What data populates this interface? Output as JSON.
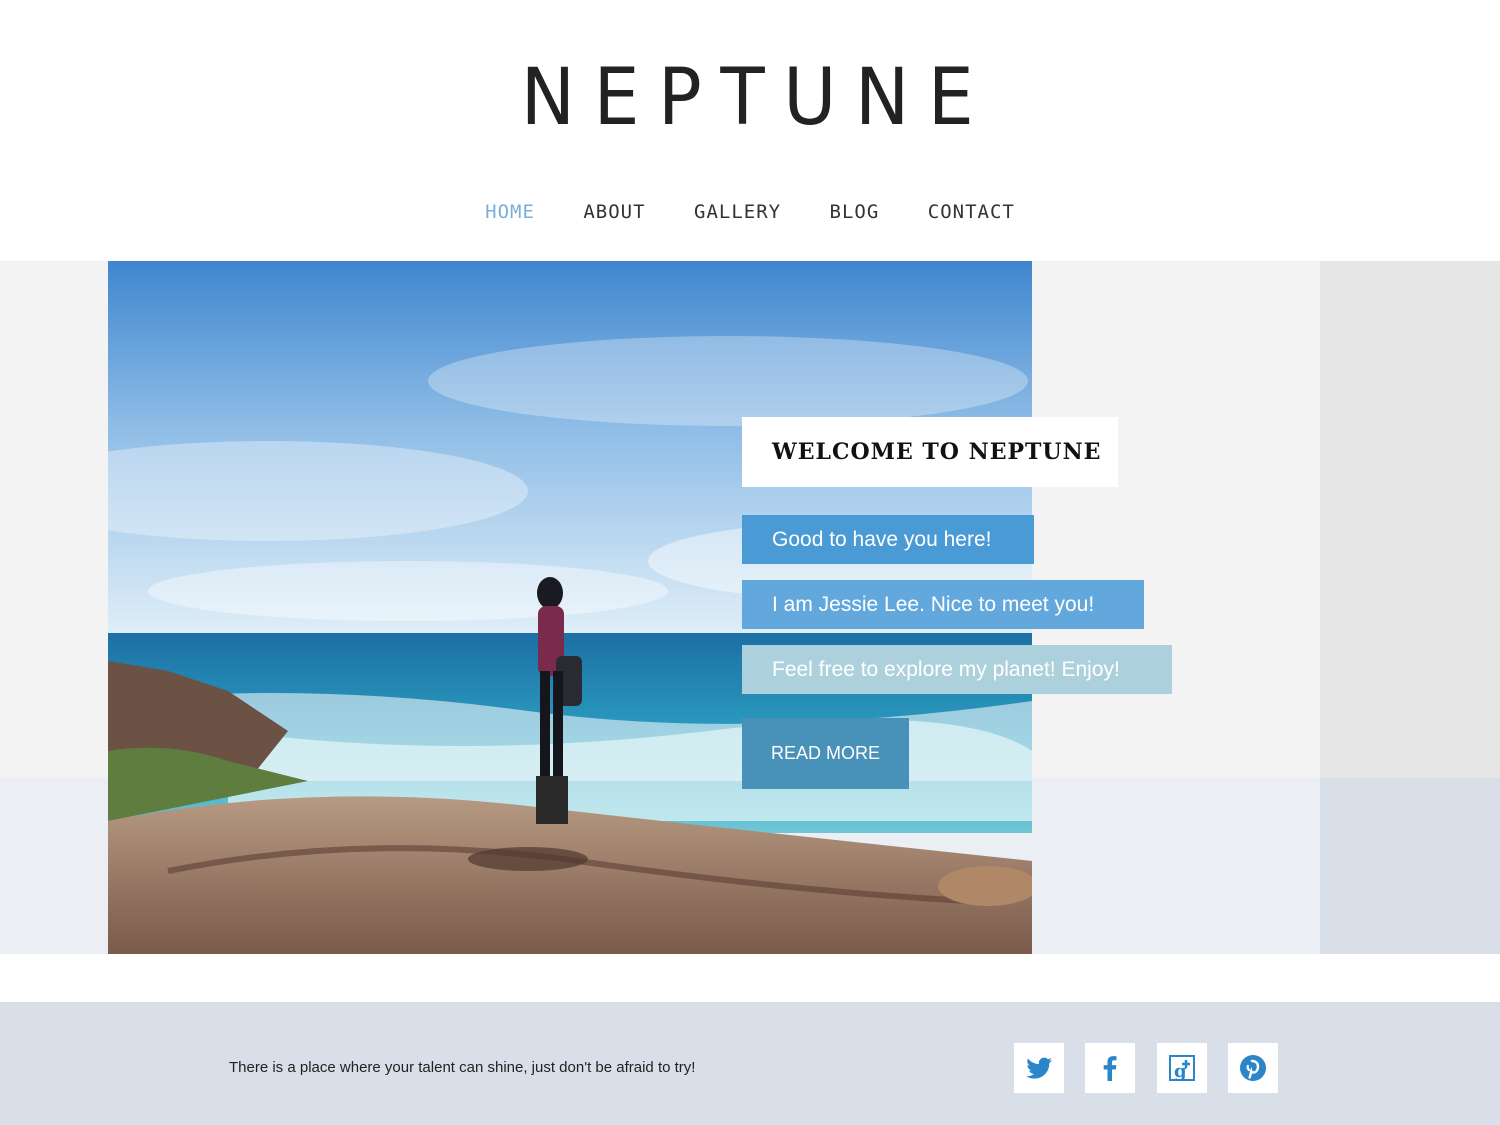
{
  "header": {
    "logo": "NEPTUNE",
    "nav": [
      {
        "label": "HOME",
        "active": true
      },
      {
        "label": "ABOUT",
        "active": false
      },
      {
        "label": "GALLERY",
        "active": false
      },
      {
        "label": "BLOG",
        "active": false
      },
      {
        "label": "CONTACT",
        "active": false
      }
    ]
  },
  "hero": {
    "image_icon": "beach-photo",
    "welcome_title": "WELCOME TO NEPTUNE",
    "messages": [
      "Good to have you here!",
      "I am Jessie Lee. Nice to meet you!",
      "Feel free to explore my planet! Enjoy!"
    ],
    "read_more_label": "READ MORE"
  },
  "footer": {
    "tagline": "There is a place where your talent can shine, just don't be afraid to try!",
    "social": [
      {
        "icon": "twitter-icon"
      },
      {
        "icon": "facebook-icon"
      },
      {
        "icon": "google-plus-icon"
      },
      {
        "icon": "pinterest-icon"
      }
    ]
  },
  "colors": {
    "accent": "#4a9ad6",
    "nav_active": "#7aaede",
    "social_icon": "#2b86c9"
  }
}
